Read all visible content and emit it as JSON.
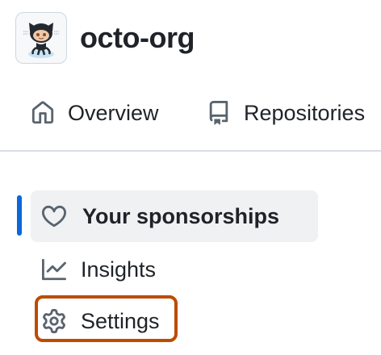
{
  "org": {
    "name": "octo-org",
    "avatar_icon": "octocat-icon"
  },
  "tabs": [
    {
      "label": "Overview",
      "icon": "home-icon"
    },
    {
      "label": "Repositories",
      "icon": "repo-icon"
    }
  ],
  "menu": {
    "items": [
      {
        "label": "Your sponsorships",
        "icon": "heart-icon",
        "active": true
      },
      {
        "label": "Insights",
        "icon": "graph-icon",
        "active": false
      },
      {
        "label": "Settings",
        "icon": "gear-icon",
        "active": false,
        "highlighted": true
      }
    ]
  },
  "colors": {
    "active_indicator": "#0969da",
    "highlight_border": "#bc4c00",
    "active_background": "#eff1f3",
    "text": "#1f2328",
    "icon": "#59636e",
    "divider": "#d8dee4"
  }
}
